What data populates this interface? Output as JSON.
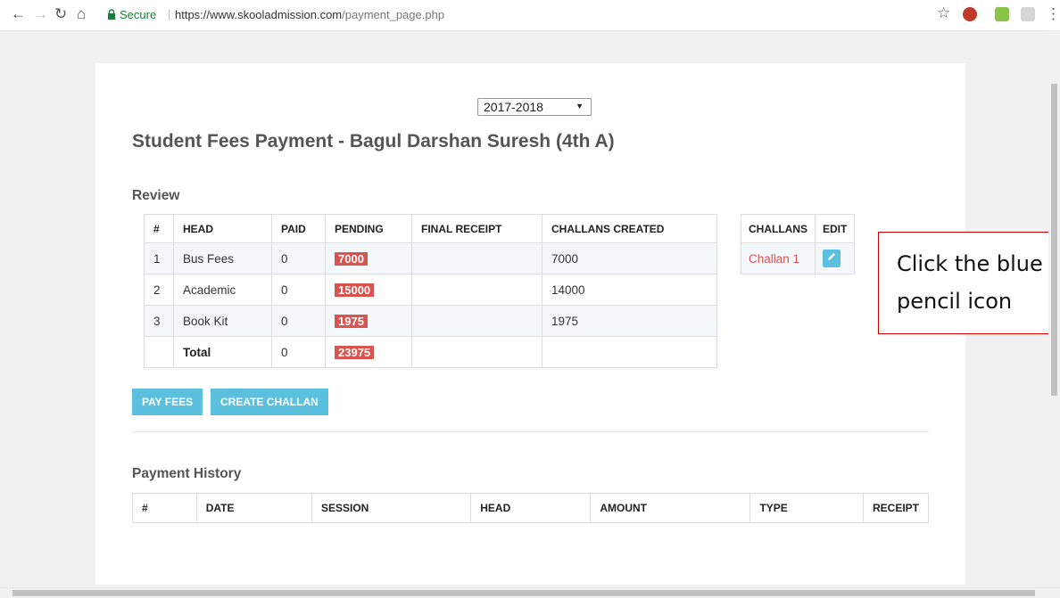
{
  "browser": {
    "secure_label": "Secure",
    "url_base": "https://www.skooladmission.com",
    "url_path": "/payment_page.php"
  },
  "page": {
    "session_selected": "2017-2018",
    "title": "Student Fees Payment - Bagul Darshan Suresh (4th A)",
    "review_title": "Review",
    "history_title": "Payment History"
  },
  "review_table": {
    "headers": [
      "#",
      "HEAD",
      "PAID",
      "PENDING",
      "FINAL RECEIPT",
      "CHALLANS CREATED"
    ],
    "rows": [
      {
        "num": "1",
        "head": "Bus Fees",
        "paid": "0",
        "pending": "7000",
        "final_receipt": "",
        "challans_created": "7000"
      },
      {
        "num": "2",
        "head": "Academic",
        "paid": "0",
        "pending": "15000",
        "final_receipt": "",
        "challans_created": "14000"
      },
      {
        "num": "3",
        "head": "Book Kit",
        "paid": "0",
        "pending": "1975",
        "final_receipt": "",
        "challans_created": "1975"
      }
    ],
    "total": {
      "label": "Total",
      "paid": "0",
      "pending": "23975"
    }
  },
  "challans_table": {
    "headers": [
      "CHALLANS",
      "EDIT"
    ],
    "rows": [
      {
        "challan": "Challan 1",
        "edit_icon": "pencil-icon"
      }
    ]
  },
  "buttons": {
    "pay_fees": "PAY FEES",
    "create_challan": "CREATE CHALLAN"
  },
  "history_table": {
    "headers": [
      "#",
      "DATE",
      "SESSION",
      "HEAD",
      "AMOUNT",
      "TYPE",
      "RECEIPT"
    ]
  },
  "callout": {
    "line1": "Click the blue",
    "line2": "pencil icon"
  },
  "colors": {
    "accent": "#5bc0de",
    "badge": "#d9534f",
    "callout_border": "#cc0000"
  }
}
